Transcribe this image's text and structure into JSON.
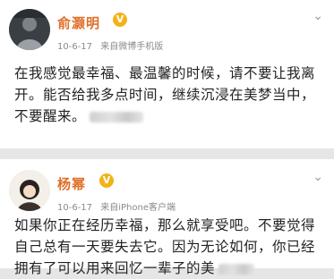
{
  "post1": {
    "author": "俞灏明",
    "date": "10-6-17",
    "source": "来自微博手机版",
    "verified_mark": "V",
    "text": "在我感觉最幸福、最温馨的时候，请不要让我离开。能否给我多点时间，继续沉浸在美梦当中，不要醒来。"
  },
  "post2": {
    "author": "杨幂",
    "date": "10-6-17",
    "source": "来自iPhone客户端",
    "verified_mark": "V",
    "text": "如果你正在经历幸福，那么就享受吧。不要觉得自己总有一天要失去它。因为无论如何，你已经拥有了可以用来回忆一辈子的美"
  },
  "icons": {
    "dropdown": "chevron-down-icon",
    "verified": "verified-badge-icon"
  },
  "colors": {
    "name": "#e06f2a",
    "badge": "#f2b318",
    "meta": "#8a8a8a"
  }
}
